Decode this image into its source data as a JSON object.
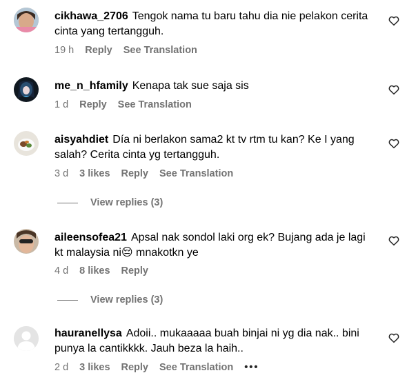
{
  "comments": [
    {
      "username": "cikhawa_2706",
      "text": "Tengok nama tu baru tahu dia nie pelakon cerita cinta yang tertangguh.",
      "time": "19 h",
      "reply": "Reply",
      "translate": "See Translation"
    },
    {
      "username": "me_n_hfamily",
      "text": "Kenapa tak sue saja sis",
      "time": "1 d",
      "reply": "Reply",
      "translate": "See Translation"
    },
    {
      "username": "aisyahdiet",
      "text": "Día ni berlakon sama2 kt tv rtm tu kan? Ke I yang salah? Cerita cinta yg tertangguh.",
      "time": "3 d",
      "likes": "3 likes",
      "reply": "Reply",
      "translate": "See Translation",
      "view_replies": "View replies (3)"
    },
    {
      "username": "aileensofea21",
      "text_before": "Apsal nak sondol laki org ek? Bujang ada je lagi kt malaysia ni",
      "emoji": "😔",
      "text_after": " mnakotkn ye",
      "time": "4 d",
      "likes": "8 likes",
      "reply": "Reply",
      "view_replies": "View replies (3)"
    },
    {
      "username": "hauranellysa",
      "text": "Adoii.. mukaaaaa buah binjai ni yg dia nak.. bini punya la cantikkkk. Jauh beza la haih..",
      "time": "2 d",
      "likes": "3 likes",
      "reply": "Reply",
      "translate": "See Translation",
      "more": "•••"
    }
  ],
  "icons": {
    "like": "heart-outline-icon",
    "more": "more-horizontal-icon"
  }
}
